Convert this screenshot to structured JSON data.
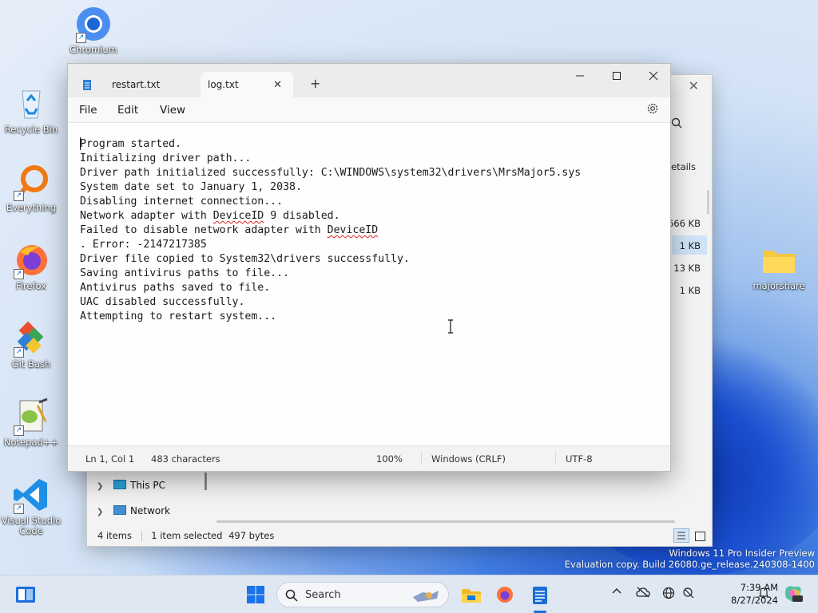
{
  "desktop": {
    "icons": [
      {
        "label": "Chromium"
      },
      {
        "label": "Recycle Bin"
      },
      {
        "label": "Everything"
      },
      {
        "label": "Firefox"
      },
      {
        "label": "Git Bash"
      },
      {
        "label": "Notepad++"
      },
      {
        "label": "Visual Studio Code"
      },
      {
        "label": "majorshare"
      }
    ],
    "watermark_line1": "Windows 11 Pro Insider Preview",
    "watermark_line2": "Evaluation copy. Build 26080.ge_release.240308-1400"
  },
  "explorer": {
    "toolbar_details": "etails",
    "sizes": [
      "666 KB",
      "1 KB",
      "13 KB",
      "1 KB"
    ],
    "nav_this_pc": "This PC",
    "nav_network": "Network",
    "status_items": "4 items",
    "status_selected": "1 item selected",
    "status_bytes": "497 bytes"
  },
  "notepad": {
    "tabs": [
      {
        "label": "restart.txt"
      },
      {
        "label": "log.txt"
      }
    ],
    "menu": {
      "file": "File",
      "edit": "Edit",
      "view": "View"
    },
    "lines": [
      "Program started.",
      "Initializing driver path...",
      "Driver path initialized successfully: C:\\WINDOWS\\system32\\drivers\\MrsMajor5.sys",
      "System date set to January 1, 2038.",
      "Disabling internet connection...",
      "Network adapter with ",
      "DeviceID",
      " 9 disabled.",
      "Failed to disable network adapter with ",
      "DeviceID",
      ". Error: -2147217385",
      "Driver file copied to System32\\drivers successfully.",
      "Saving antivirus paths to file...",
      "Antivirus paths saved to file.",
      "UAC disabled successfully.",
      "Attempting to restart system..."
    ],
    "status": {
      "position": "Ln 1, Col 1",
      "characters": "483 characters",
      "zoom": "100%",
      "line_ending": "Windows (CRLF)",
      "encoding": "UTF-8"
    }
  },
  "taskbar": {
    "search_placeholder": "Search",
    "time": "7:39 AM",
    "date": "8/27/2024"
  }
}
